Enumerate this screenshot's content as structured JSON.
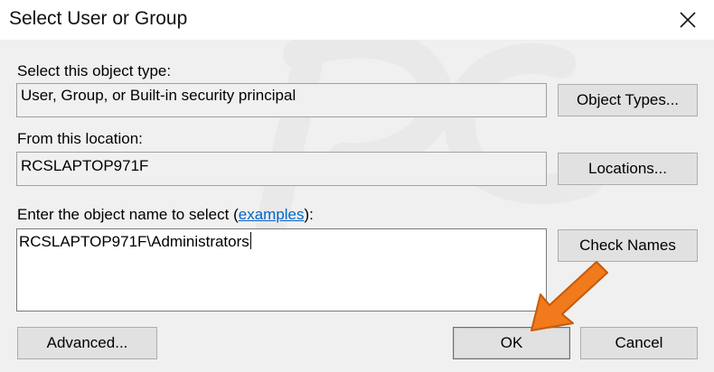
{
  "window": {
    "title": "Select User or Group",
    "close_icon": "close-icon"
  },
  "object_type": {
    "label": "Select this object type:",
    "value": "User, Group, or Built-in security principal",
    "button_label": "Object Types..."
  },
  "location": {
    "label": "From this location:",
    "value": "RCSLAPTOP971F",
    "button_label": "Locations..."
  },
  "object_name": {
    "label_prefix": "Enter the object name to select (",
    "label_link": "examples",
    "label_suffix": "):",
    "value": "RCSLAPTOP971F\\Administrators",
    "check_names_label": "Check Names"
  },
  "footer": {
    "advanced_label": "Advanced...",
    "ok_label": "OK",
    "cancel_label": "Cancel"
  },
  "colors": {
    "dialog_background": "#f0f0f0",
    "titlebar_background": "#ffffff",
    "link": "#0066cc",
    "annotation_arrow": "#f07a1c"
  }
}
